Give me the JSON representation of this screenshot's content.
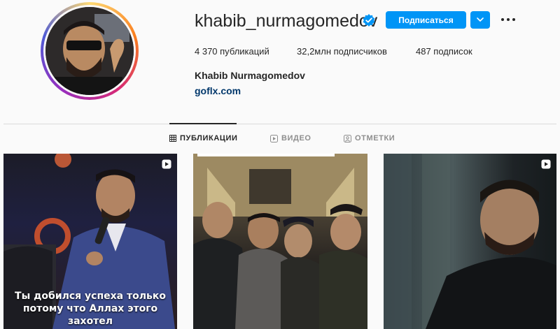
{
  "profile": {
    "username": "khabib_nurmagomedov",
    "verified": true,
    "full_name": "Khabib Nurmagomedov",
    "link": "goflx.com",
    "follow_label": "Подписаться",
    "more_icon": "ellipsis-icon",
    "dropdown_icon": "chevron-down-icon"
  },
  "stats": {
    "posts": "4 370 публикаций",
    "followers": "32,2млн подписчиков",
    "following": "487 подписок"
  },
  "tabs": [
    {
      "label": "ПУБЛИКАЦИИ",
      "icon": "grid-icon",
      "active": true
    },
    {
      "label": "ВИДЕО",
      "icon": "video-icon",
      "active": false
    },
    {
      "label": "ОТМЕТКИ",
      "icon": "tagged-icon",
      "active": false
    }
  ],
  "posts": [
    {
      "type": "reel",
      "caption_line1": "Ты добился успеха только",
      "caption_line2": "потому что Аллах этого захотел"
    },
    {
      "type": "photo"
    },
    {
      "type": "reel"
    }
  ],
  "colors": {
    "accent": "#0095f6",
    "text": "#262626",
    "muted": "#8e8e8e",
    "link": "#00376b",
    "background": "#fafafa"
  }
}
